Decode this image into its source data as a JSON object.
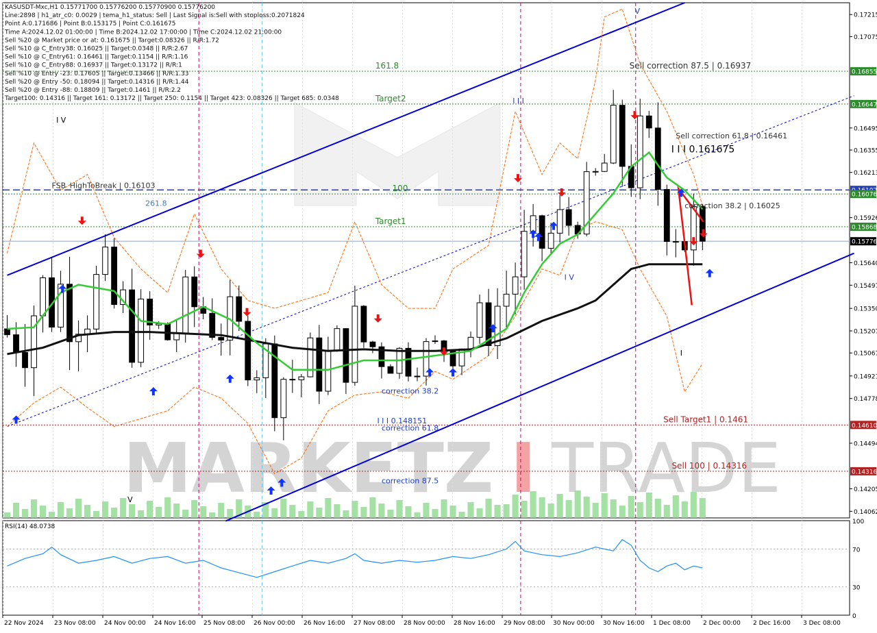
{
  "colors": {
    "background": "#ffffff",
    "candle": "#000000",
    "ma_green": "#33cc33",
    "ma_black": "#111111",
    "envelope": "#ff6600",
    "channel": "#0000dd",
    "buy_arrow": "#1133ff",
    "sell_arrow": "#ee1111",
    "level_green": "#2e8b2e",
    "level_red": "#b22222",
    "level_blue": "#1f3fbf",
    "separator_magenta": "#cc0077",
    "rsi_line": "#1e90ff",
    "watermark": "#d4d4d4",
    "watermark_accent": "#f3a3a3"
  },
  "info_panel": [
    "KASUSDT-Mxc,H1  0.15771700 0.15776200 0.15770900 0.15776200",
    "Line:2898 | h1_atr_c0: 0.0029 | tema_h1_status: Sell | Last Signal is:Sell with stoploss:0.2071824",
    "Point A:0.171686 | Point B:0.153175 | Point C:0.161675",
    "Time A:2024.12.02 01:00:00 | Time B:2024.12.02 17:00:00 | Time C:2024.12.02 21:00:00",
    "Sell %20 @ Market price or at: 0.161675 || Target:0.08326 || R/R:1.72",
    "Sell %10 @ C_Entry38: 0.16025 || Target:0.0348 || R/R:2.67",
    "Sell %10 @ C_Entry61: 0.16461 || Target:0.1154 || R/R:1.16",
    "Sell %10 @ C_Entry88: 0.16937 || Target:0.13172 || R/R:1",
    "Sell %10 @ Entry -23: 0.17605 || Target:0.13466 || R/R:1.33",
    "Sell %20 @ Entry -50: 0.18094 || Target:0.14316 || R/R:1.44",
    "Sell %20 @ Entry -88: 0.18809 || Target:0.1461 || R/R:2.2",
    "Target100: 0.14316 || Target 161: 0.13172 || Target 250: 0.1154 || Target 423: 0.08326 || Target 685: 0.0348"
  ],
  "chart_data": {
    "type": "candlestick",
    "symbol": "KASUSDT-Mxc",
    "timeframe": "H1",
    "x_ticks": [
      "22 Nov 2024",
      "23 Nov 08:00",
      "24 Nov 00:00",
      "24 Nov 16:00",
      "25 Nov 08:00",
      "26 Nov 00:00",
      "26 Nov 16:00",
      "27 Nov 08:00",
      "28 Nov 00:00",
      "28 Nov 16:00",
      "29 Nov 08:00",
      "30 Nov 00:00",
      "30 Nov 16:00",
      "1 Dec 08:00",
      "2 Dec 00:00",
      "2 Dec 16:00",
      "3 Dec 08:00"
    ],
    "y_ticks": [
      "0.17215",
      "0.17075",
      "0.16495",
      "0.16355",
      "0.16213",
      "0.15926",
      "0.15640",
      "0.15497",
      "0.15350",
      "0.15207",
      "0.15067",
      "0.14921",
      "0.14778",
      "0.14494",
      "0.14205",
      "0.14062"
    ],
    "ylim": [
      0.1402,
      0.1729
    ],
    "price_tags": [
      {
        "value": 0.16855,
        "label": "0.16855",
        "color": "#2e8b2e"
      },
      {
        "value": 0.16647,
        "label": "0.16647",
        "color": "#2e8b2e"
      },
      {
        "value": 0.16102,
        "label": "0.16102",
        "color": "#1f3fbf"
      },
      {
        "value": 0.16076,
        "label": "0.16076",
        "color": "#2e8b2e"
      },
      {
        "value": 0.15868,
        "label": "0.15868",
        "color": "#2e8b2e"
      },
      {
        "value": 0.15776,
        "label": "0.15776",
        "color": "#000000"
      },
      {
        "value": 0.1461,
        "label": "0.14610",
        "color": "#b22222"
      },
      {
        "value": 0.14316,
        "label": "0.14316",
        "color": "#b22222"
      }
    ],
    "levels": [
      {
        "value": 0.16855,
        "style": "dotted",
        "color": "#2e8b2e",
        "label": "161.8",
        "label_at": 0.44
      },
      {
        "value": 0.16855,
        "style": "none",
        "color": "#333333",
        "label": "Sell correction 87.5 | 0.16937",
        "label_at": 0.74
      },
      {
        "value": 0.16647,
        "style": "dotted",
        "color": "#2e8b2e",
        "label": "Target2",
        "label_at": 0.44
      },
      {
        "value": 0.16102,
        "style": "dashed",
        "color": "#1f3fbf",
        "label": "",
        "label_at": 0
      },
      {
        "value": 0.16076,
        "style": "dotted",
        "color": "#2e8b2e",
        "label": "100",
        "label_at": 0.46
      },
      {
        "value": 0.15868,
        "style": "dotted",
        "color": "#2e8b2e",
        "label": "Target1",
        "label_at": 0.44
      },
      {
        "value": 0.15776,
        "style": "solid",
        "color": "#8aa0d8",
        "label": "",
        "label_at": 0
      },
      {
        "value": 0.1461,
        "style": "dotted",
        "color": "#b22222",
        "label": "Sell Target1 | 0.1461",
        "label_at": 0.78
      },
      {
        "value": 0.14316,
        "style": "dotted",
        "color": "#b22222",
        "label": "Sell 100 | 0.14316",
        "label_at": 0.79
      }
    ],
    "texts": [
      {
        "text": "Sell correction 61.8 | 0.16461",
        "x": 75,
        "y": 0.1643,
        "color": "#333333"
      },
      {
        "text": "I I I 0.161675",
        "x": 74.5,
        "y": 0.1634,
        "color": "#000000"
      },
      {
        "text": "correction 38.2 | 0.16025",
        "x": 76,
        "y": 0.15985,
        "color": "#333333"
      },
      {
        "text": "FSB_HighToBreak | 0.16103",
        "x": 5,
        "y": 0.16113,
        "color": "#333333"
      },
      {
        "text": "261.8",
        "x": 15.5,
        "y": 0.16,
        "color": "#4a7ab0"
      },
      {
        "text": "correction 38.2",
        "x": 42,
        "y": 0.1481,
        "color": "#1f3fbf"
      },
      {
        "text": "I I I 0.148151",
        "x": 41.5,
        "y": 0.1462,
        "color": "#1f3fbf"
      },
      {
        "text": "correction 61.8",
        "x": 42,
        "y": 0.14575,
        "color": "#1f3fbf"
      },
      {
        "text": "correction 87.5",
        "x": 42,
        "y": 0.1424,
        "color": "#1f3fbf"
      },
      {
        "text": "I V",
        "x": 5.5,
        "y": 0.1653,
        "color": "#000000"
      },
      {
        "text": "V",
        "x": 13.5,
        "y": 0.1412,
        "color": "#000000"
      },
      {
        "text": "I I I",
        "x": 56.7,
        "y": 0.1665,
        "color": "#1f3fbf"
      },
      {
        "text": "I V",
        "x": 62.5,
        "y": 0.1553,
        "color": "#1f3fbf"
      },
      {
        "text": "V",
        "x": 70.4,
        "y": 0.1722,
        "color": "#1f3fbf"
      },
      {
        "text": "I",
        "x": 75.5,
        "y": 0.1505,
        "color": "#000000"
      }
    ],
    "separators": [
      {
        "x": 21.5,
        "color": "#cc0077"
      },
      {
        "x": 28.6,
        "color": "#66c6e8"
      },
      {
        "x": 57.6,
        "color": "#cc0077"
      },
      {
        "x": 70.5,
        "color": "#cc0077"
      }
    ],
    "ma_green": [
      [
        0,
        0.1522
      ],
      [
        3,
        0.1523
      ],
      [
        6,
        0.1545
      ],
      [
        8,
        0.155
      ],
      [
        12,
        0.1546
      ],
      [
        15,
        0.1527
      ],
      [
        18,
        0.1525
      ],
      [
        22,
        0.1536
      ],
      [
        25,
        0.1528
      ],
      [
        28,
        0.1513
      ],
      [
        32,
        0.1496
      ],
      [
        36,
        0.1496
      ],
      [
        40,
        0.1502
      ],
      [
        44,
        0.1502
      ],
      [
        48,
        0.1505
      ],
      [
        52,
        0.1508
      ],
      [
        56,
        0.1522
      ],
      [
        58,
        0.1545
      ],
      [
        60,
        0.1563
      ],
      [
        62,
        0.1576
      ],
      [
        64,
        0.1582
      ],
      [
        66,
        0.1595
      ],
      [
        68,
        0.1608
      ],
      [
        70,
        0.1625
      ],
      [
        72,
        0.1634
      ],
      [
        74,
        0.1618
      ],
      [
        76,
        0.161
      ],
      [
        78,
        0.1598
      ]
    ],
    "ma_black": [
      [
        0,
        0.1506
      ],
      [
        4,
        0.151
      ],
      [
        8,
        0.1518
      ],
      [
        12,
        0.152
      ],
      [
        16,
        0.152
      ],
      [
        20,
        0.1519
      ],
      [
        24,
        0.1518
      ],
      [
        28,
        0.1514
      ],
      [
        32,
        0.151
      ],
      [
        36,
        0.1508
      ],
      [
        40,
        0.1509
      ],
      [
        44,
        0.1508
      ],
      [
        48,
        0.1508
      ],
      [
        52,
        0.1509
      ],
      [
        56,
        0.1516
      ],
      [
        60,
        0.1527
      ],
      [
        64,
        0.1535
      ],
      [
        66,
        0.154
      ],
      [
        68,
        0.155
      ],
      [
        70,
        0.156
      ],
      [
        72,
        0.1563
      ],
      [
        74,
        0.1563
      ],
      [
        76,
        0.1563
      ],
      [
        78,
        0.1563
      ]
    ],
    "envelope_upper": [
      [
        0,
        0.157
      ],
      [
        3,
        0.164
      ],
      [
        6,
        0.161
      ],
      [
        9,
        0.162
      ],
      [
        12,
        0.158
      ],
      [
        15,
        0.156
      ],
      [
        18,
        0.1545
      ],
      [
        21,
        0.1595
      ],
      [
        24,
        0.156
      ],
      [
        27,
        0.154
      ],
      [
        30,
        0.1535
      ],
      [
        33,
        0.154
      ],
      [
        36,
        0.1545
      ],
      [
        39,
        0.159
      ],
      [
        42,
        0.155
      ],
      [
        45,
        0.1535
      ],
      [
        48,
        0.1535
      ],
      [
        50,
        0.156
      ],
      [
        54,
        0.1575
      ],
      [
        57,
        0.166
      ],
      [
        60,
        0.162
      ],
      [
        62,
        0.164
      ],
      [
        64,
        0.163
      ],
      [
        66,
        0.168
      ],
      [
        67,
        0.172
      ],
      [
        69,
        0.1725
      ],
      [
        71,
        0.169
      ],
      [
        74,
        0.166
      ],
      [
        77,
        0.162
      ],
      [
        78,
        0.16
      ]
    ],
    "envelope_lower": [
      [
        0,
        0.146
      ],
      [
        3,
        0.1475
      ],
      [
        6,
        0.1485
      ],
      [
        9,
        0.1472
      ],
      [
        12,
        0.146
      ],
      [
        15,
        0.1465
      ],
      [
        18,
        0.147
      ],
      [
        21,
        0.1485
      ],
      [
        24,
        0.1478
      ],
      [
        27,
        0.1462
      ],
      [
        30,
        0.143
      ],
      [
        33,
        0.144
      ],
      [
        36,
        0.147
      ],
      [
        39,
        0.148
      ],
      [
        42,
        0.1482
      ],
      [
        45,
        0.1478
      ],
      [
        48,
        0.1495
      ],
      [
        50,
        0.149
      ],
      [
        54,
        0.1505
      ],
      [
        57,
        0.153
      ],
      [
        60,
        0.156
      ],
      [
        62,
        0.1556
      ],
      [
        64,
        0.1585
      ],
      [
        66,
        0.159
      ],
      [
        69,
        0.1585
      ],
      [
        71,
        0.156
      ],
      [
        74,
        0.153
      ],
      [
        76,
        0.1482
      ],
      [
        78,
        0.15
      ]
    ],
    "channel": [
      {
        "p1": [
          0,
          0.1556
        ],
        "p2": [
          76,
          0.1729
        ],
        "style": "solid",
        "width": 2
      },
      {
        "p1": [
          24.5,
          0.14
        ],
        "p2": [
          95,
          0.157
        ],
        "style": "solid",
        "width": 2
      },
      {
        "p1": [
          0,
          0.146
        ],
        "p2": [
          95,
          0.167
        ],
        "style": "dotted",
        "width": 1
      }
    ],
    "triangle": [
      [
        75.3,
        0.1611
      ],
      [
        78.1,
        0.159
      ],
      [
        76.8,
        0.1537
      ]
    ],
    "buy_arrows": [
      [
        1,
        0.1467
      ],
      [
        6.2,
        0.155
      ],
      [
        16.4,
        0.1485
      ],
      [
        25,
        0.1493
      ],
      [
        30.8,
        0.1427
      ],
      [
        29.6,
        0.1422
      ],
      [
        47.4,
        0.1497
      ],
      [
        50,
        0.1497
      ],
      [
        54.5,
        0.1525
      ],
      [
        59,
        0.1585
      ],
      [
        59.6,
        0.1583
      ],
      [
        61.3,
        0.159
      ],
      [
        75.6,
        0.1611
      ],
      [
        78.8,
        0.156
      ]
    ],
    "sell_arrows": [
      [
        8.4,
        0.1588
      ],
      [
        21.7,
        0.1567
      ],
      [
        26.9,
        0.153
      ],
      [
        41.6,
        0.1526
      ],
      [
        49,
        0.1505
      ],
      [
        57.3,
        0.1615
      ],
      [
        62.2,
        0.1606
      ],
      [
        70.4,
        0.1655
      ],
      [
        77,
        0.1575
      ],
      [
        78.1,
        0.158
      ]
    ],
    "rsi": {
      "label": "RSI(14) 48.0738",
      "ylim": [
        0,
        100
      ],
      "y_ticks": [
        100,
        70,
        30,
        0
      ],
      "y_tick_labels": [
        "100",
        "70",
        "30",
        "0"
      ],
      "values": [
        [
          0,
          52
        ],
        [
          2,
          60
        ],
        [
          4,
          65
        ],
        [
          5,
          72
        ],
        [
          6,
          64
        ],
        [
          8,
          55
        ],
        [
          10,
          58
        ],
        [
          12,
          62
        ],
        [
          14,
          55
        ],
        [
          16,
          60
        ],
        [
          18,
          62
        ],
        [
          20,
          55
        ],
        [
          22,
          58
        ],
        [
          24,
          50
        ],
        [
          26,
          45
        ],
        [
          28,
          40
        ],
        [
          30,
          46
        ],
        [
          32,
          52
        ],
        [
          34,
          58
        ],
        [
          36,
          55
        ],
        [
          38,
          60
        ],
        [
          39,
          65
        ],
        [
          40,
          58
        ],
        [
          42,
          55
        ],
        [
          44,
          58
        ],
        [
          46,
          56
        ],
        [
          48,
          58
        ],
        [
          50,
          62
        ],
        [
          52,
          60
        ],
        [
          54,
          64
        ],
        [
          56,
          70
        ],
        [
          57,
          78
        ],
        [
          58,
          68
        ],
        [
          60,
          64
        ],
        [
          62,
          62
        ],
        [
          64,
          66
        ],
        [
          66,
          72
        ],
        [
          68,
          68
        ],
        [
          69,
          80
        ],
        [
          70,
          74
        ],
        [
          71,
          58
        ],
        [
          72,
          50
        ],
        [
          73,
          46
        ],
        [
          74,
          52
        ],
        [
          75,
          55
        ],
        [
          76,
          48
        ],
        [
          77,
          52
        ],
        [
          78,
          50
        ]
      ]
    },
    "watermark": {
      "text_left": "MARKETZ",
      "text_mid": "I",
      "text_right": "TRADE"
    }
  }
}
